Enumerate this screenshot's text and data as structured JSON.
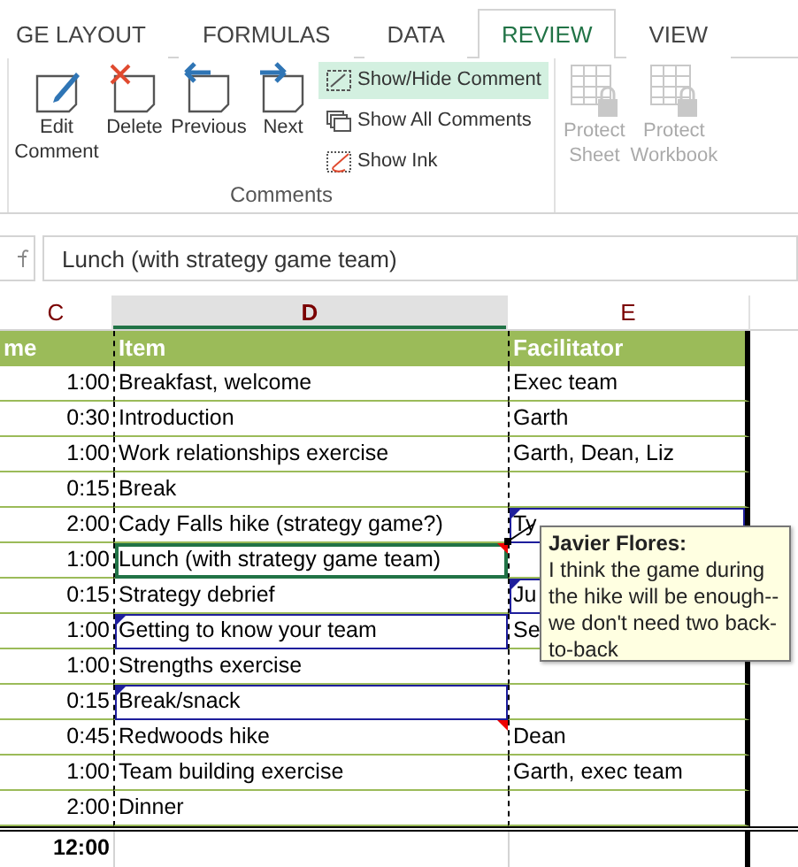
{
  "tabs": [
    {
      "label": "GE LAYOUT",
      "selected": false
    },
    {
      "label": "FORMULAS",
      "selected": false
    },
    {
      "label": "DATA",
      "selected": false
    },
    {
      "label": "REVIEW",
      "selected": true
    },
    {
      "label": "VIEW",
      "selected": false
    }
  ],
  "ribbon": {
    "big_buttons": [
      {
        "kind": "edit",
        "label": "Edit Comment"
      },
      {
        "kind": "delete",
        "label": "Delete"
      },
      {
        "kind": "previous",
        "label": "Previous"
      },
      {
        "kind": "next",
        "label": "Next"
      }
    ],
    "small_buttons": [
      {
        "kind": "showhide",
        "label": "Show/Hide Comment",
        "highlighted": true
      },
      {
        "kind": "showall",
        "label": "Show All Comments",
        "highlighted": false
      },
      {
        "kind": "ink",
        "label": "Show Ink",
        "highlighted": false
      }
    ],
    "group_label": "Comments",
    "protect_buttons": [
      {
        "label": "Protect Sheet",
        "disabled": true
      },
      {
        "label": "Protect Workbook",
        "disabled": true
      }
    ]
  },
  "formula_bar": {
    "value": "Lunch (with strategy game team)"
  },
  "column_headers": [
    {
      "label": "C",
      "selected": false
    },
    {
      "label": "D",
      "selected": true
    },
    {
      "label": "E",
      "selected": false
    }
  ],
  "table": {
    "header": [
      "me",
      "Item",
      "Facilitator"
    ],
    "rows": [
      {
        "duration": "1:00",
        "item": {
          "text": "Breakfast, welcome",
          "selected": false,
          "comment": false,
          "outlined": false
        },
        "facilitator": {
          "text": "Exec team",
          "outlined": false
        }
      },
      {
        "duration": "0:30",
        "item": {
          "text": "Introduction",
          "selected": false,
          "comment": false,
          "outlined": false
        },
        "facilitator": {
          "text": "Garth",
          "outlined": false
        }
      },
      {
        "duration": "1:00",
        "item": {
          "text": "Work relationships exercise",
          "selected": false,
          "comment": false,
          "outlined": false
        },
        "facilitator": {
          "text": "Garth, Dean, Liz",
          "outlined": false
        }
      },
      {
        "duration": "0:15",
        "item": {
          "text": "Break",
          "selected": false,
          "comment": false,
          "outlined": false
        },
        "facilitator": {
          "outlined": false
        }
      },
      {
        "duration": "2:00",
        "item": {
          "text": "Cady Falls hike (strategy game?)",
          "selected": false,
          "comment": false,
          "outlined": false
        },
        "facilitator": {
          "text": "Ty",
          "outlined": true
        }
      },
      {
        "duration": "1:00",
        "item": {
          "text": "Lunch (with strategy game team)",
          "selected": true,
          "comment": true,
          "outlined": false
        },
        "facilitator": {
          "outlined": false
        }
      },
      {
        "duration": "0:15",
        "item": {
          "text": "Strategy debrief",
          "selected": false,
          "comment": false,
          "outlined": false
        },
        "facilitator": {
          "text": "Ju",
          "outlined": true
        }
      },
      {
        "duration": "1:00",
        "item": {
          "text": "Getting to know your team",
          "selected": false,
          "comment": false,
          "outlined": true
        },
        "facilitator": {
          "text": "Se",
          "outlined": false
        }
      },
      {
        "duration": "1:00",
        "item": {
          "text": "Strengths exercise",
          "selected": false,
          "comment": false,
          "outlined": false
        },
        "facilitator": {
          "outlined": false
        }
      },
      {
        "duration": "0:15",
        "item": {
          "text": "Break/snack",
          "selected": false,
          "comment": false,
          "outlined": true
        },
        "facilitator": {
          "outlined": false
        }
      },
      {
        "duration": "0:45",
        "item": {
          "text": "Redwoods hike",
          "selected": false,
          "comment": true,
          "outlined": false
        },
        "facilitator": {
          "text": "Dean",
          "outlined": false
        }
      },
      {
        "duration": "1:00",
        "item": {
          "text": "Team building exercise",
          "selected": false,
          "comment": false,
          "outlined": false
        },
        "facilitator": {
          "text": "Garth, exec team",
          "outlined": false
        }
      },
      {
        "duration": "2:00",
        "item": {
          "text": "Dinner",
          "selected": false,
          "comment": false,
          "outlined": false
        },
        "facilitator": {
          "outlined": false
        }
      }
    ],
    "total": "12:00"
  },
  "comment": {
    "author": "Javier Flores:",
    "text": "I think the game during the hike will be enough--we don't need two back-to-back"
  }
}
